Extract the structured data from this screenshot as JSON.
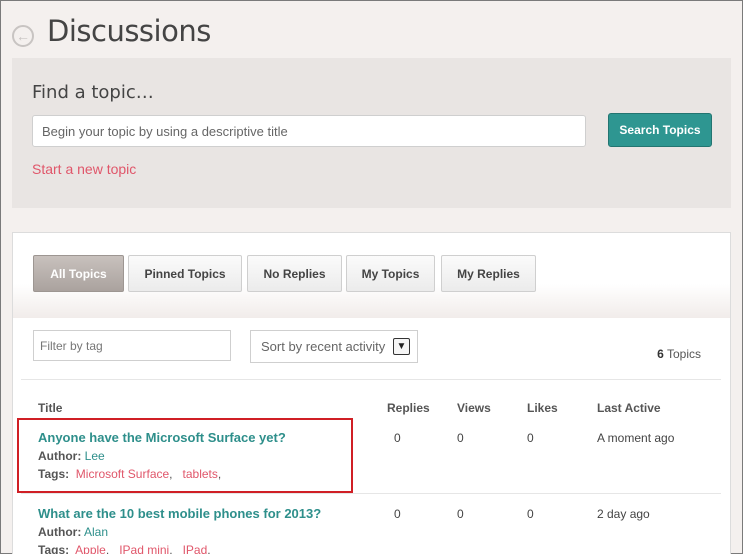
{
  "page": {
    "title": "Discussions",
    "back_icon": "back-arrow-icon"
  },
  "find": {
    "label": "Find a topic…",
    "search_placeholder": "Begin your topic by using a descriptive title",
    "search_value": "",
    "search_button": "Search Topics",
    "new_topic_link": "Start a new topic"
  },
  "tabs": [
    {
      "label": "All Topics",
      "active": true
    },
    {
      "label": "Pinned Topics",
      "active": false
    },
    {
      "label": "No Replies",
      "active": false
    },
    {
      "label": "My Topics",
      "active": false
    },
    {
      "label": "My Replies",
      "active": false
    }
  ],
  "filters": {
    "tag_placeholder": "Filter by tag",
    "sort_value": "Sort by recent activity",
    "count": "6",
    "count_label": "Topics"
  },
  "columns": {
    "title": "Title",
    "replies": "Replies",
    "views": "Views",
    "likes": "Likes",
    "last_active": "Last Active"
  },
  "topics": [
    {
      "title": "Anyone have the Microsoft Surface yet?",
      "author_label": "Author:",
      "author": "Lee",
      "tags_label": "Tags:",
      "tags": [
        "Microsoft Surface",
        "tablets"
      ],
      "replies": "0",
      "views": "0",
      "likes": "0",
      "last_active": "A moment ago"
    },
    {
      "title": "What are the 10 best mobile phones for 2013?",
      "author_label": "Author:",
      "author": "Alan",
      "tags_label": "Tags:",
      "tags": [
        "Apple",
        "IPad mini",
        "IPad"
      ],
      "replies": "0",
      "views": "0",
      "likes": "0",
      "last_active": "2 day ago"
    }
  ],
  "colors": {
    "accent_teal": "#2e9691",
    "link_pink": "#e0566a",
    "highlight_red": "#d01f25"
  }
}
